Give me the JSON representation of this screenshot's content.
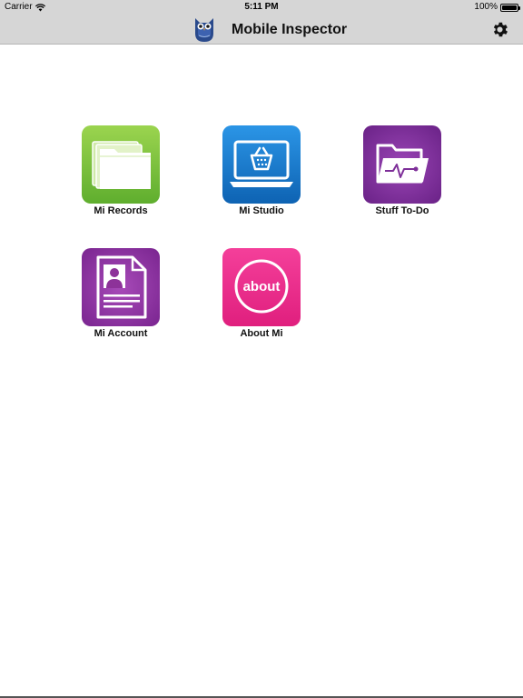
{
  "status_bar": {
    "carrier": "Carrier",
    "time": "5:11 PM",
    "battery": "100%"
  },
  "nav": {
    "title": "Mobile Inspector",
    "logo_icon": "owl-icon",
    "settings_icon": "gear-icon"
  },
  "tiles": [
    {
      "label": "Mi Records",
      "icon": "folders-icon",
      "color": "#7cc242"
    },
    {
      "label": "Mi Studio",
      "icon": "laptop-basket-icon",
      "color": "#1a7fd0"
    },
    {
      "label": "Stuff To-Do",
      "icon": "folder-pulse-icon",
      "color": "#7e2f99"
    },
    {
      "label": "Mi Account",
      "icon": "account-card-icon",
      "color": "#8d3299"
    },
    {
      "label": "About Mi",
      "icon": "about-icon",
      "color": "#ee2a8c",
      "icon_text": "about"
    }
  ]
}
